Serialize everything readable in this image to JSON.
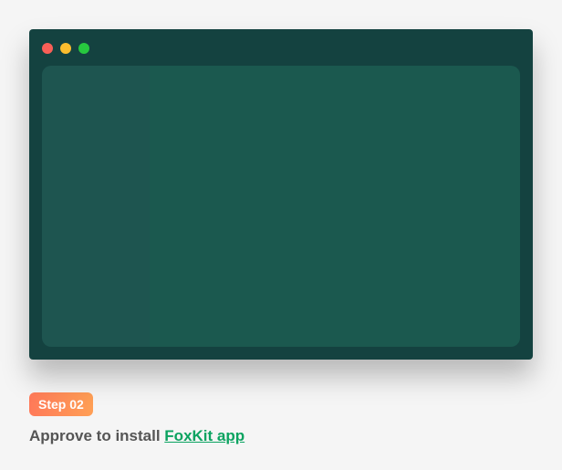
{
  "step": {
    "badge": "Step 02",
    "instruction_prefix": "Approve to install ",
    "link_text": "FoxKit app"
  }
}
